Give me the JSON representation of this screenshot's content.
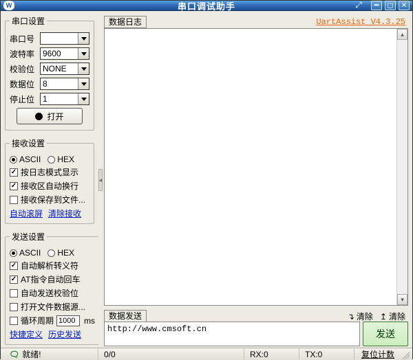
{
  "titlebar": {
    "title": "串口调试助手",
    "app_icon_text": "W"
  },
  "port": {
    "legend": "串口设置",
    "port_label": "串口号",
    "port_value": "",
    "baud_label": "波特率",
    "baud_value": "9600",
    "parity_label": "校验位",
    "parity_value": "NONE",
    "databits_label": "数据位",
    "databits_value": "8",
    "stopbits_label": "停止位",
    "stopbits_value": "1",
    "open_button": "打开"
  },
  "recv": {
    "legend": "接收设置",
    "mode_ascii": "ASCII",
    "mode_hex": "HEX",
    "selected_mode": "ASCII",
    "log_mode_label": "按日志模式显示",
    "log_mode_checked": true,
    "autowrap_label": "接收区自动换行",
    "autowrap_checked": true,
    "save_file_label": "接收保存到文件...",
    "save_file_checked": false,
    "autoscroll_link": "自动滚屏",
    "clear_link": "清除接收"
  },
  "send": {
    "legend": "发送设置",
    "mode_ascii": "ASCII",
    "mode_hex": "HEX",
    "selected_mode": "ASCII",
    "escape_label": "自动解析转义符",
    "escape_checked": true,
    "at_echo_label": "AT指令自动回车",
    "at_echo_checked": true,
    "autocheck_label": "自动发送校验位",
    "autocheck_checked": false,
    "open_file_label": "打开文件数据源...",
    "open_file_checked": false,
    "cycle_label": "循环周期",
    "cycle_value": "1000",
    "cycle_unit": "ms",
    "cycle_checked": false,
    "quick_link": "快捷定义",
    "history_link": "历史发送"
  },
  "log": {
    "tab_label": "数据日志",
    "version_link": "UartAssist V4.3.25"
  },
  "sendbox": {
    "tab_label": "数据发送",
    "clear1": "清除",
    "clear2": "清除",
    "input_value": "http://www.cmsoft.cn",
    "send_button": "发送"
  },
  "status": {
    "ready_label": "就绪!",
    "counter1": "0/0",
    "rx": "RX:0",
    "tx": "TX:0",
    "reset_link": "复位计数"
  }
}
